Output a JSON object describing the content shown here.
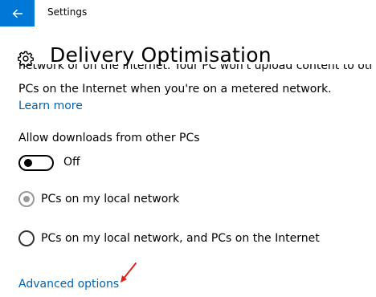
{
  "window": {
    "title": "Settings"
  },
  "page": {
    "title": "Delivery Optimisation"
  },
  "description": {
    "clipped_line": "network or on the Internet. Your PC won't upload content to other",
    "line": "PCs on the Internet when you're on a metered network."
  },
  "links": {
    "learn_more": "Learn more",
    "advanced_options": "Advanced options"
  },
  "allow_downloads": {
    "label": "Allow downloads from other PCs",
    "state": "Off"
  },
  "options": [
    {
      "label": "PCs on my local network",
      "selected": true,
      "enabled": false
    },
    {
      "label": "PCs on my local network, and PCs on the Internet",
      "selected": false,
      "enabled": false
    }
  ],
  "colors": {
    "accent": "#0078d7",
    "link": "#0063b1",
    "annotation_arrow": "#e0201c"
  },
  "icons": {
    "back": "back-arrow-icon",
    "settings": "gear-icon",
    "annotation": "red-arrow-icon"
  }
}
